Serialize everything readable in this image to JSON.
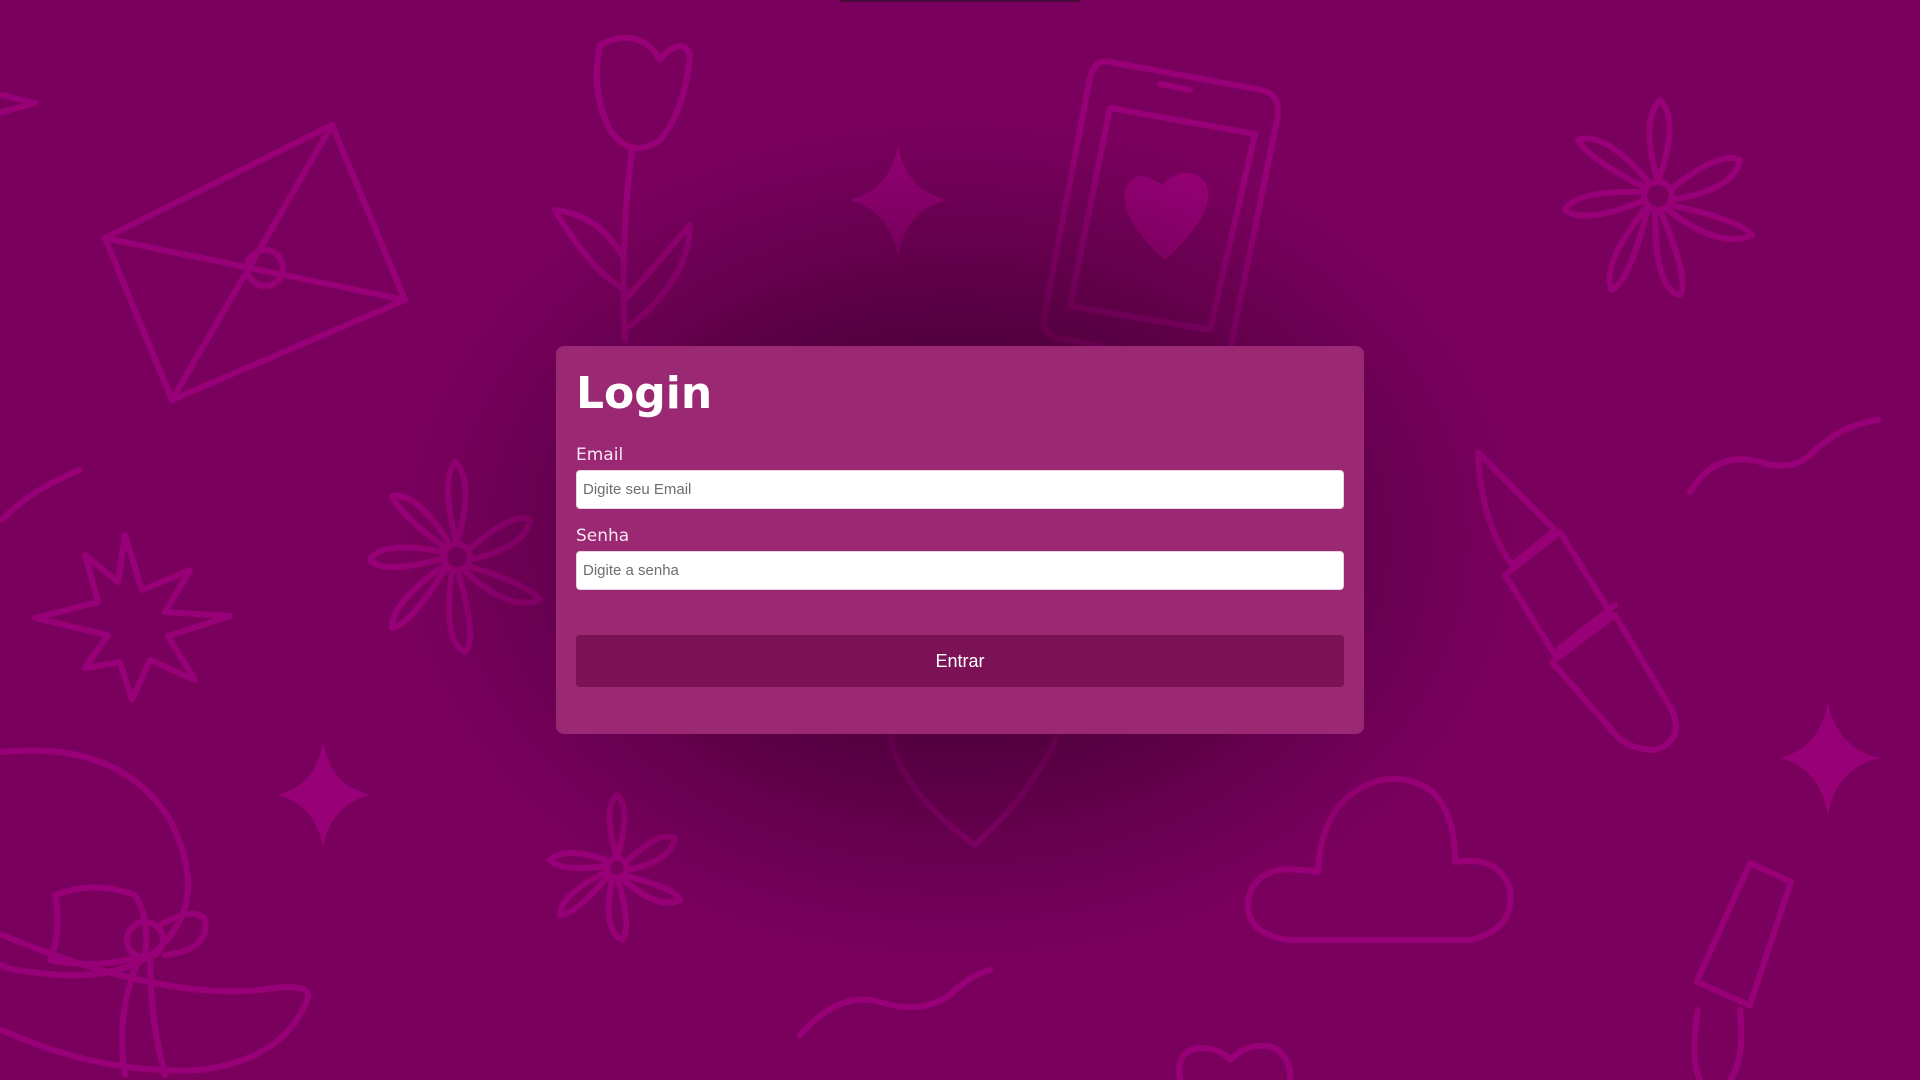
{
  "colors": {
    "background": "#7a005e",
    "pattern_stroke": "#980077",
    "card_background": "#9b2873",
    "button_background": "#7b1256",
    "text": "#ffffff"
  },
  "background_pattern": {
    "icons": [
      "envelope-icon",
      "rose-icon",
      "sparkle-icon",
      "phone-heart-icon",
      "flower-icon",
      "starburst-icon",
      "lipstick-icon",
      "squiggle-icon",
      "hat-with-bow-icon",
      "heart-icon",
      "cloud-icon",
      "nail-polish-icon"
    ]
  },
  "login": {
    "title": "Login",
    "email": {
      "label": "Email",
      "placeholder": "Digite seu Email",
      "value": ""
    },
    "password": {
      "label": "Senha",
      "placeholder": "Digite a senha",
      "value": ""
    },
    "submit_label": "Entrar"
  }
}
